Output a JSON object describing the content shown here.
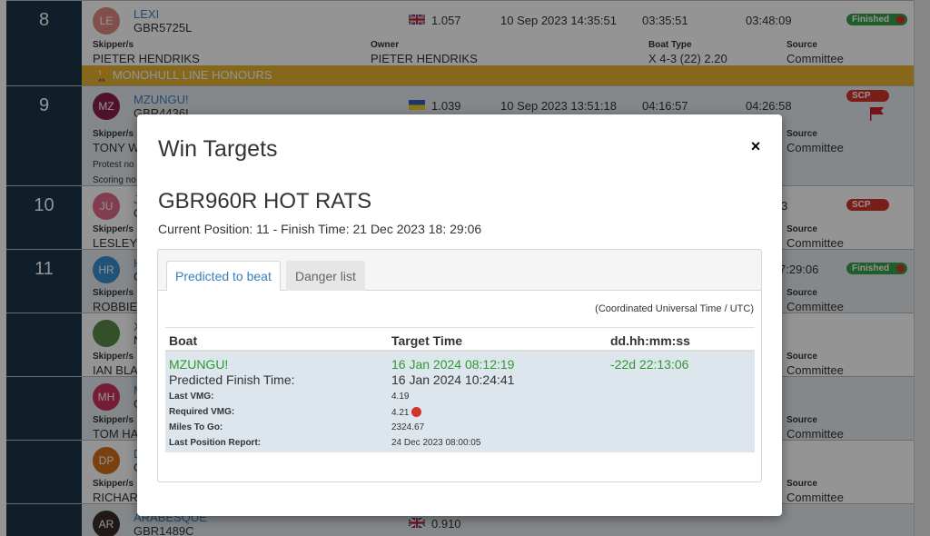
{
  "background": {
    "entries": [
      {
        "position": "8",
        "initials": "LE",
        "boat_name": "LEXI",
        "sail_no": "GBR5725L",
        "flag": "uk-flag",
        "rating": "1.057",
        "start": "10 Sep 2023 14:35:51",
        "elapsed": "03:35:51",
        "corrected": "03:48:09",
        "status": "Finished",
        "skipper_label": "Skipper/s",
        "skipper": "PIETER HENDRIKS",
        "owner_label": "Owner",
        "owner": "PIETER HENDRIKS",
        "type_label": "Boat Type",
        "type": "X 4-3 (22) 2.20",
        "source_label": "Source",
        "source": "Committee"
      },
      {
        "position": "9",
        "initials": "MZ",
        "boat_name": "MZUNGU!",
        "sail_no": "GBR4436L",
        "flag": "ukraine-flag",
        "rating": "1.039",
        "start": "10 Sep 2023 13:51:18",
        "elapsed": "04:16:57",
        "corrected": "04:26:58",
        "status": "SCP",
        "skipper_label": "Skipper/s",
        "skipper": "TONY W",
        "source_label": "Source",
        "source": "Committee",
        "protest_label": "Protest no",
        "scoring_label": "Scoring no"
      },
      {
        "position": "10",
        "initials": "JU",
        "boat_name": "J",
        "sail_no": "G",
        "corrected_partial": "3",
        "status": "SCP",
        "skipper_label": "Skipper/s",
        "skipper": "LESLEY",
        "source_label": "Source",
        "source": "Committee"
      },
      {
        "position": "11",
        "initials": "HR",
        "boat_name": "H",
        "sail_no": "G",
        "corrected_partial": "7:29:06",
        "status": "Finished",
        "skipper_label": "Skipper/s",
        "skipper": "ROBBIE",
        "source_label": "Source",
        "source": "Committee"
      },
      {
        "initials": "",
        "boat_name": "X",
        "sail_no": "N",
        "skipper_label": "Skipper/s",
        "skipper": "IAN BLA",
        "source_label": "Source",
        "source": "Committee"
      },
      {
        "initials": "MH",
        "boat_name": "M",
        "sail_no": "G",
        "skipper_label": "Skipper/s",
        "skipper": "TOM HA",
        "source_label": "Source",
        "source": "Committee"
      },
      {
        "initials": "DP",
        "boat_name": "D",
        "sail_no": "G",
        "skipper_label": "Skipper/s",
        "skipper": "RICHAR",
        "source_label": "Source",
        "source": "Committee"
      },
      {
        "initials": "AR",
        "boat_name": "ARABESQUE",
        "sail_no": "GBR1489C",
        "flag": "uk-flag",
        "rating": "0.910"
      }
    ],
    "honours_banner": "MONOHULL LINE HONOURS"
  },
  "modal": {
    "title": "Win Targets",
    "close_label": "×",
    "boat_heading": "GBR960R HOT RATS",
    "subline": "Current Position: 11 - Finish Time: 21 Dec 2023 18: 29:06",
    "tabs": [
      {
        "label": "Predicted to beat",
        "active": true
      },
      {
        "label": "Danger list",
        "active": false
      }
    ],
    "timezone_note": "(Coordinated Universal Time / UTC)",
    "table": {
      "headers": [
        "Boat",
        "Target Time",
        "dd.hh:mm:ss"
      ],
      "rows": [
        {
          "boat": "MZUNGU!",
          "target_time": "16 Jan 2024 08:12:19",
          "delta": "-22d 22:13:06",
          "predicted_finish_label": "Predicted Finish Time:",
          "predicted_finish": "16 Jan 2024 10:24:41",
          "details": [
            {
              "label": "Last VMG:",
              "value": "4.19"
            },
            {
              "label": "Required VMG:",
              "value": "4.21",
              "indicator": "red-dot"
            },
            {
              "label": "Miles To Go:",
              "value": "2324.67"
            },
            {
              "label": "Last Position Report:",
              "value": "24 Dec 2023 08:00:05"
            }
          ]
        }
      ]
    }
  }
}
